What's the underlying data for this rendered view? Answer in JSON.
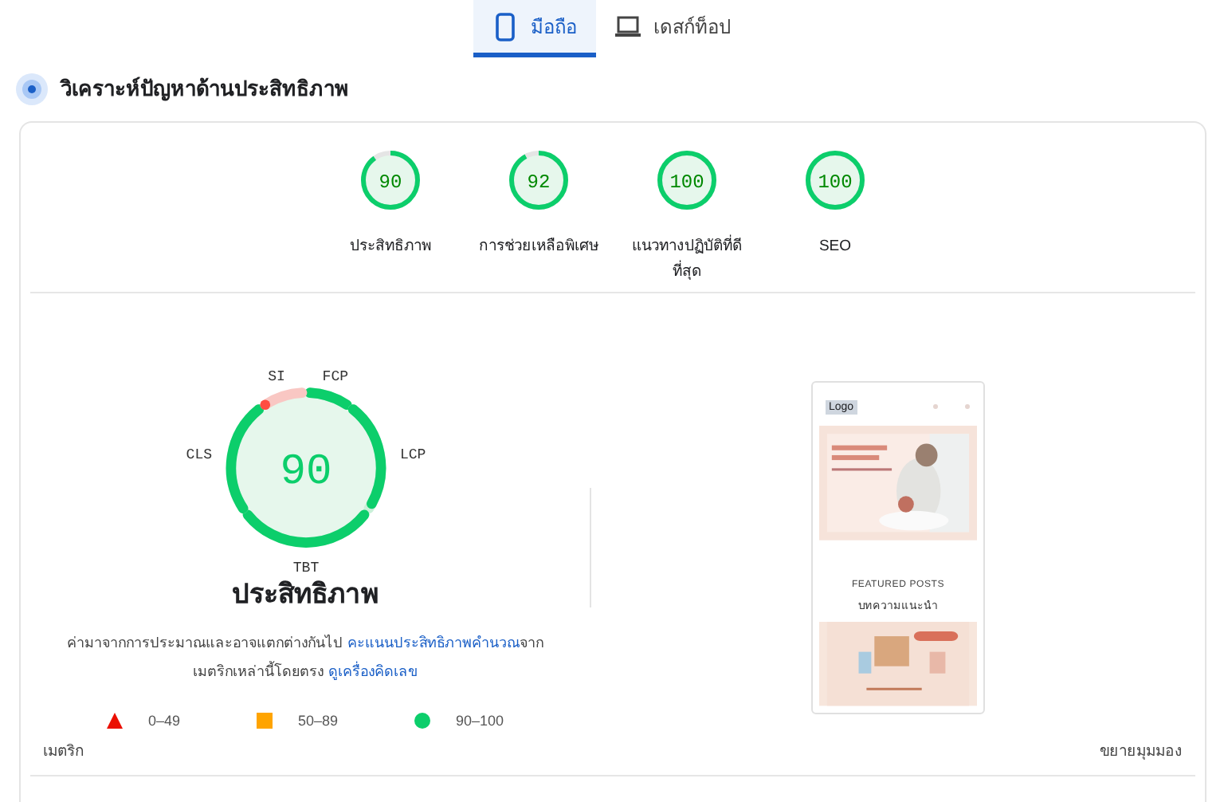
{
  "tabs": [
    {
      "label": "มือถือ",
      "kind": "phone",
      "selected": true
    },
    {
      "label": "เดสก์ท็อป",
      "kind": "laptop",
      "selected": false
    }
  ],
  "section_title": "วิเคราะห์ปัญหาด้านประสิทธิภาพ",
  "categories": [
    {
      "score": "90",
      "label": "ประสิทธิภาพ",
      "level": 0.9
    },
    {
      "score": "92",
      "label": "การช่วยเหลือพิเศษ",
      "level": 0.92
    },
    {
      "score": "100",
      "label": "แนวทางปฏิบัติที่ดีที่สุด",
      "level": 1
    },
    {
      "score": "100",
      "label": "SEO",
      "level": 1
    }
  ],
  "performance": {
    "score": "90",
    "title": "ประสิทธิภาพ",
    "metrics": [
      {
        "label": "FCP",
        "level": 1,
        "kind": "pass"
      },
      {
        "label": "LCP",
        "level": 0.95,
        "kind": "pass"
      },
      {
        "label": "TBT",
        "level": 1,
        "kind": "pass"
      },
      {
        "label": "CLS",
        "level": 1,
        "kind": "pass"
      },
      {
        "label": "SI",
        "level": 0.05,
        "kind": "fail"
      }
    ],
    "description": {
      "before": "ค่ามาจากการประมาณและอาจแตกต่างกันไป ",
      "link1": "คะแนนประสิทธิภาพคำนวณ",
      "middle": "จากเมตริกเหล่านี้โดยตรง ",
      "link2": "ดูเครื่องคิดเลข"
    },
    "legend": [
      {
        "kind": "triangle",
        "label": "0–49"
      },
      {
        "kind": "square",
        "label": "50–89"
      },
      {
        "kind": "circle",
        "label": "90–100"
      }
    ]
  },
  "screenshot": {
    "logo": "Logo",
    "heading": "FEATURED POSTS",
    "subheading": "บทความแนะนำ"
  },
  "metrics_heading": "เมตริก",
  "expand_view": "ขยายมุมมอง"
}
